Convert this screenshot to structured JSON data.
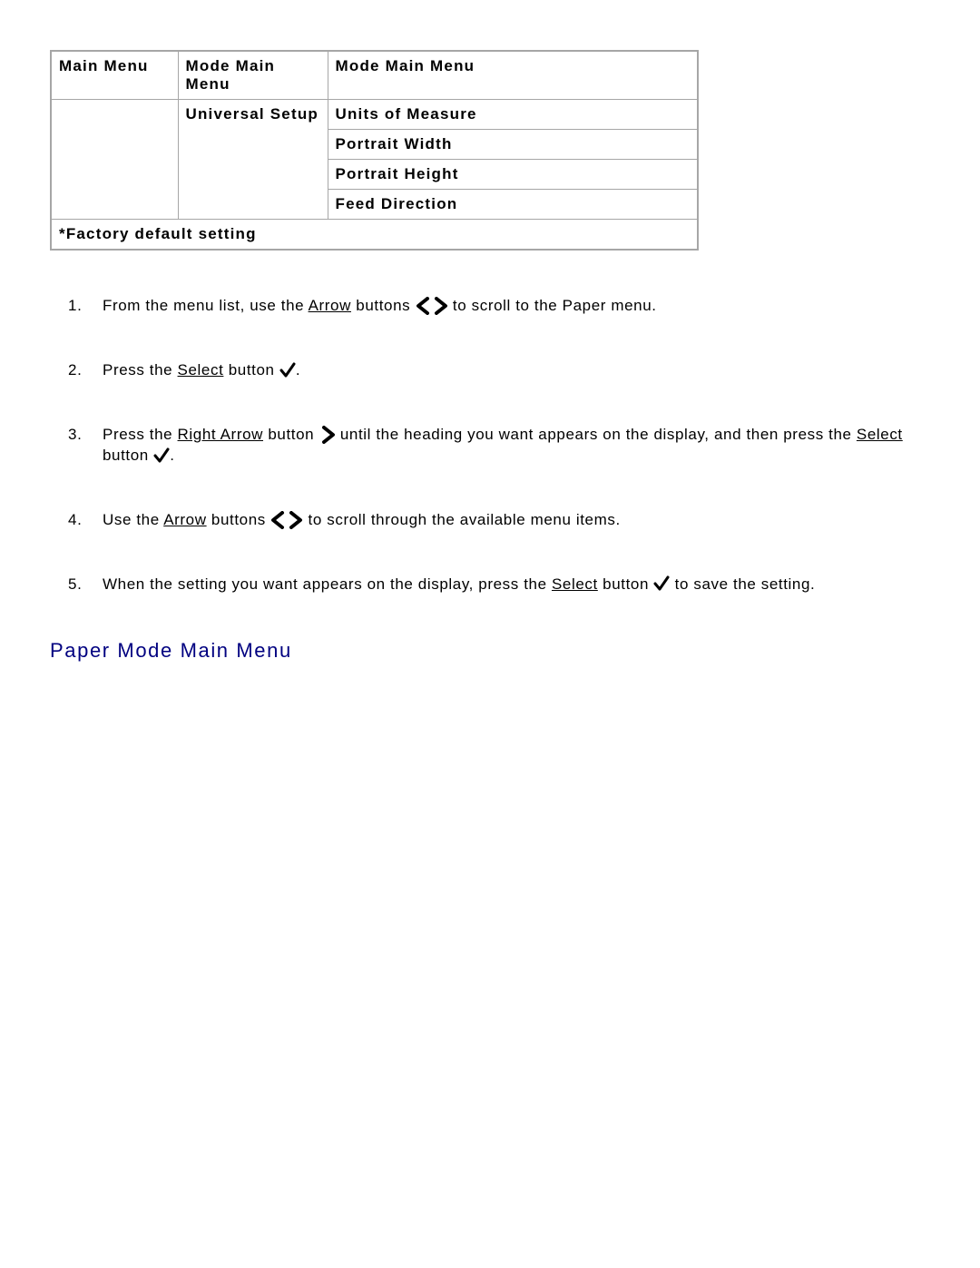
{
  "table": {
    "headers": [
      "Main Menu",
      "Mode Main Menu",
      "Mode Main Menu"
    ],
    "col2_sub": "Universal Setup",
    "col3_items": [
      "Units of Measure",
      "Portrait Width",
      "Portrait Height",
      "Feed Direction"
    ],
    "footnote": "*Factory default setting"
  },
  "steps": [
    {
      "parts": [
        {
          "type": "text",
          "value": "From the menu list, use the "
        },
        {
          "type": "underline",
          "value": "Arrow"
        },
        {
          "type": "text",
          "value": " buttons "
        },
        {
          "type": "icon",
          "value": "arrows-lr"
        },
        {
          "type": "text",
          "value": " to scroll to the Paper menu."
        }
      ]
    },
    {
      "parts": [
        {
          "type": "text",
          "value": "Press the "
        },
        {
          "type": "underline",
          "value": "Select"
        },
        {
          "type": "text",
          "value": " button "
        },
        {
          "type": "icon",
          "value": "check"
        },
        {
          "type": "text",
          "value": "."
        }
      ]
    },
    {
      "parts": [
        {
          "type": "text",
          "value": "Press the "
        },
        {
          "type": "underline",
          "value": "Right Arrow"
        },
        {
          "type": "text",
          "value": " button "
        },
        {
          "type": "icon",
          "value": "arrow-r"
        },
        {
          "type": "text",
          "value": " until the heading you want appears on the display, and then press the "
        },
        {
          "type": "underline",
          "value": "Select"
        },
        {
          "type": "text",
          "value": " button "
        },
        {
          "type": "icon",
          "value": "check"
        },
        {
          "type": "text",
          "value": "."
        }
      ]
    },
    {
      "parts": [
        {
          "type": "text",
          "value": "Use the "
        },
        {
          "type": "underline",
          "value": "Arrow"
        },
        {
          "type": "text",
          "value": " buttons "
        },
        {
          "type": "icon",
          "value": "arrows-lr"
        },
        {
          "type": "text",
          "value": " to scroll through the available menu items."
        }
      ]
    },
    {
      "parts": [
        {
          "type": "text",
          "value": "When the setting you want appears on the display, press the "
        },
        {
          "type": "underline",
          "value": "Select"
        },
        {
          "type": "text",
          "value": " button "
        },
        {
          "type": "icon",
          "value": "check"
        },
        {
          "type": "text",
          "value": " to save the setting."
        }
      ]
    }
  ],
  "section_heading": "Paper Mode Main Menu",
  "icons": {
    "arrow_left_name": "arrow-left-icon",
    "arrow_right_name": "arrow-right-icon",
    "check_name": "check-icon"
  }
}
